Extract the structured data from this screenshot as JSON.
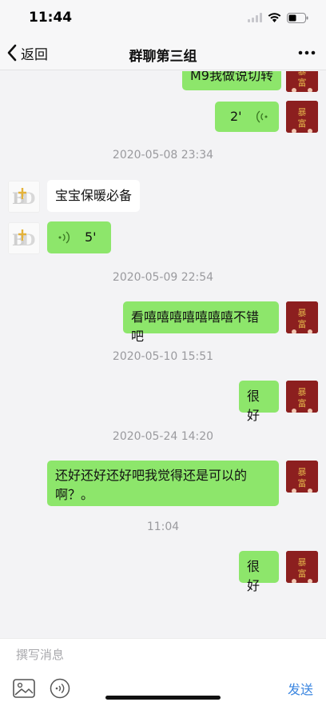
{
  "status_bar": {
    "time": "11:44"
  },
  "nav": {
    "back_label": "返回",
    "title": "群聊第三组"
  },
  "messages": [
    {
      "type": "text",
      "side": "me",
      "text": "M9我做说切转"
    },
    {
      "type": "voice",
      "side": "me",
      "duration": "2'"
    },
    {
      "type": "timestamp",
      "text": "2020-05-08 23:34"
    },
    {
      "type": "text",
      "side": "other",
      "text": "宝宝保暖必备"
    },
    {
      "type": "voice",
      "side": "other",
      "duration": "5'"
    },
    {
      "type": "timestamp",
      "text": "2020-05-09 22:54"
    },
    {
      "type": "text",
      "side": "me",
      "text": "看嘻嘻嘻嘻嘻嘻嘻不错吧"
    },
    {
      "type": "timestamp",
      "text": "2020-05-10 15:51"
    },
    {
      "type": "text",
      "side": "me",
      "text": "很好"
    },
    {
      "type": "timestamp",
      "text": "2020-05-24 14:20"
    },
    {
      "type": "text",
      "side": "me",
      "line1": "还好还好还好吧我觉得还是可以的",
      "line2": "啊？。"
    },
    {
      "type": "timestamp",
      "text": "11:04"
    },
    {
      "type": "text",
      "side": "me",
      "text": "很好"
    }
  ],
  "avatars": {
    "me_text": "暴富",
    "other_text": "BD"
  },
  "input": {
    "placeholder": "撰写消息",
    "value": ""
  },
  "toolbar": {
    "send_label": "发送"
  },
  "colors": {
    "my_bubble": "#8de66b",
    "other_bubble": "#ffffff",
    "send": "#3b86e0",
    "my_avatar": "#8c1f1f"
  },
  "icons": [
    "chevron-left-icon",
    "more-icon",
    "image-icon",
    "voice-icon",
    "wifi-icon",
    "battery-icon",
    "signal-icon"
  ]
}
